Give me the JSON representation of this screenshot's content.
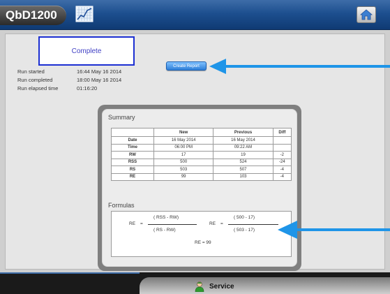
{
  "app": {
    "name": "QbD1200"
  },
  "status": {
    "label": "Complete"
  },
  "run": {
    "rows": [
      {
        "label": "Run started",
        "value": "16:44 May 16 2014"
      },
      {
        "label": "Run completed",
        "value": "18:00 May 16 2014"
      },
      {
        "label": "Run elapsed time",
        "value": "01:16:20"
      }
    ]
  },
  "actions": {
    "create_report_label": "Create Report"
  },
  "summary": {
    "title": "Summary",
    "columns": [
      "",
      "New",
      "Previous",
      "Diff"
    ],
    "rows": [
      {
        "label": "Date",
        "new": "16 May 2014",
        "previous": "16 May 2014",
        "diff": ""
      },
      {
        "label": "Time",
        "new": "06:00 PM",
        "previous": "09:22 AM",
        "diff": ""
      },
      {
        "label": "RW",
        "new": "17",
        "previous": "19",
        "diff": "-2"
      },
      {
        "label": "RSS",
        "new": "500",
        "previous": "524",
        "diff": "-24"
      },
      {
        "label": "RS",
        "new": "503",
        "previous": "507",
        "diff": "-4"
      },
      {
        "label": "RE",
        "new": "99",
        "previous": "103",
        "diff": "-4"
      }
    ]
  },
  "formulas": {
    "title": "Formulas",
    "symbolic": {
      "lhs": "RE",
      "eq": "=",
      "numerator": "( RSS  -  RW)",
      "denominator": "( RS  -  RW)"
    },
    "numeric": {
      "lhs": "RE",
      "eq": "=",
      "numerator": "( 500  -  17)",
      "denominator": "( 503  -  17)"
    },
    "result": "RE  =  99"
  },
  "footer": {
    "service_label": "Service"
  },
  "colors": {
    "top_bar": "#1d4f8f",
    "status_border": "#1c2fd2",
    "arrow": "#1f95e8"
  },
  "icons": {
    "chart": "chart-icon",
    "home": "home-icon",
    "service": "service-person-icon"
  }
}
